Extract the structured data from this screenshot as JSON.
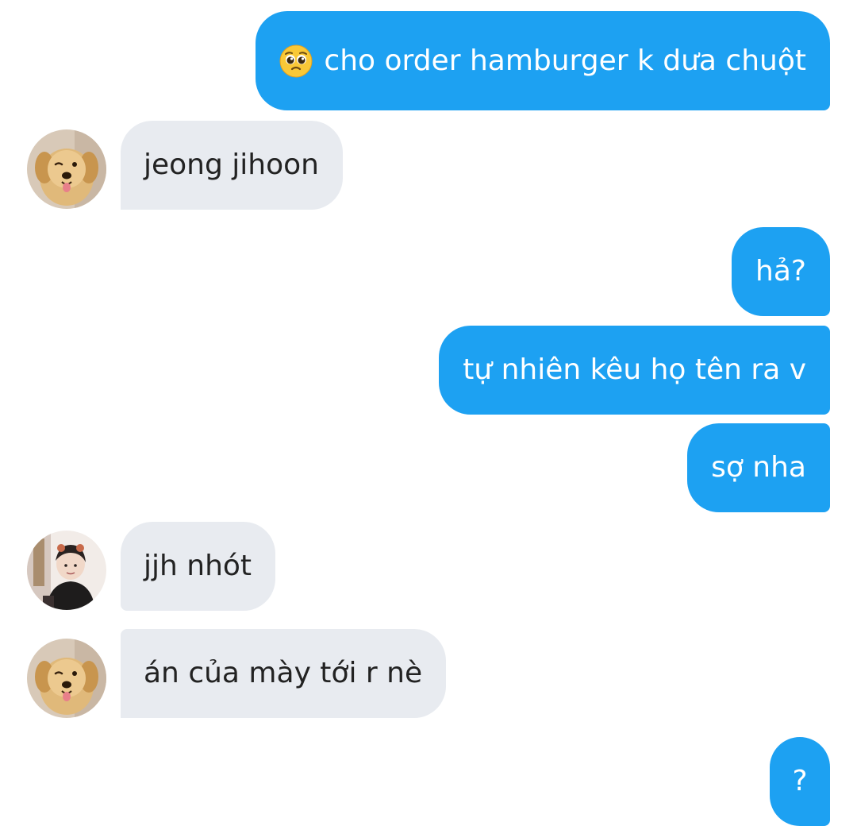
{
  "messages": [
    {
      "id": "m1",
      "direction": "outgoing",
      "emoji": "pleading-face-emoji",
      "text": "cho order hamburger k dưa chuột"
    },
    {
      "id": "m2",
      "direction": "incoming",
      "avatar": "dog-avatar",
      "text": "jeong jihoon"
    },
    {
      "id": "m3",
      "direction": "outgoing",
      "text": "hả?"
    },
    {
      "id": "m4",
      "direction": "outgoing",
      "text": "tự nhiên kêu họ tên ra v"
    },
    {
      "id": "m5",
      "direction": "outgoing",
      "text": "sợ nha"
    },
    {
      "id": "m6",
      "direction": "incoming",
      "avatar": "person-avatar",
      "text": "jjh nhót"
    },
    {
      "id": "m7",
      "direction": "incoming",
      "avatar": "dog-avatar",
      "text": "án của mày tới r nè"
    },
    {
      "id": "m8",
      "direction": "outgoing",
      "text": "?"
    }
  ],
  "colors": {
    "outgoing_bubble": "#1da1f2",
    "incoming_bubble": "#e8ebf0",
    "outgoing_text": "#ffffff",
    "incoming_text": "#222222",
    "background": "#ffffff"
  }
}
